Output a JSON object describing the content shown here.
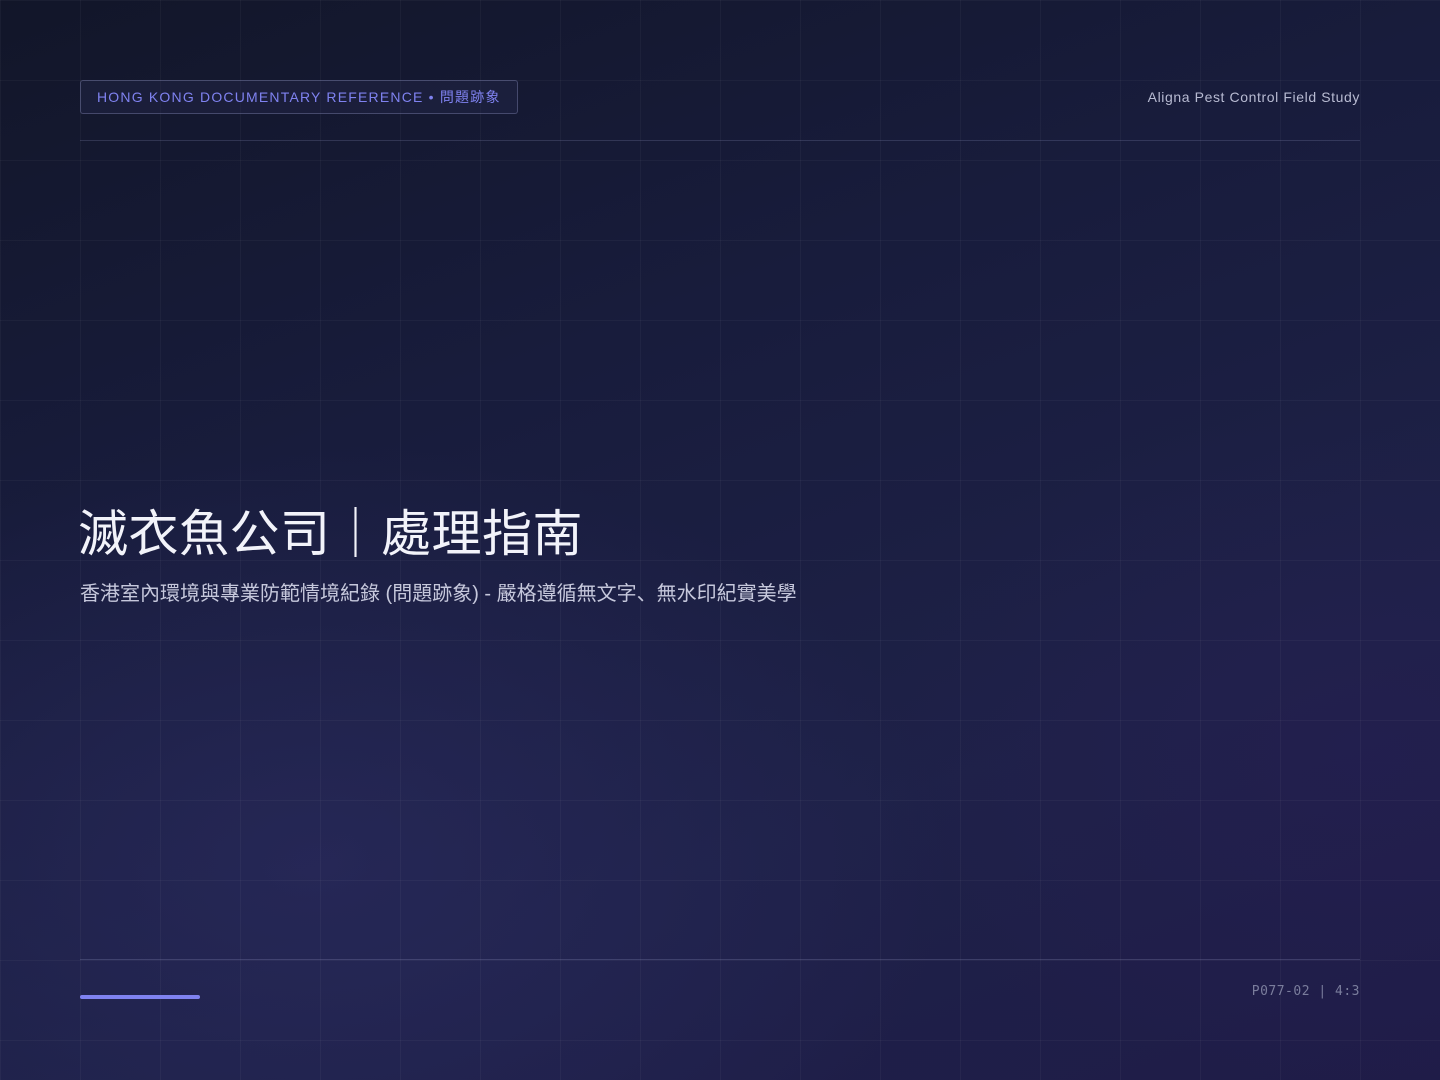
{
  "header": {
    "tag_label": "HONG KONG DOCUMENTARY REFERENCE • 問題跡象",
    "study_label": "Aligna Pest Control Field Study"
  },
  "main": {
    "title": "滅衣魚公司｜處理指南",
    "subtitle": "香港室內環境與專業防範情境紀錄 (問題跡象) - 嚴格遵循無文字、無水印紀實美學"
  },
  "footer": {
    "code": "P077-02 | 4:3"
  },
  "colors": {
    "accent": "#7f82f0",
    "background": "#181c3c"
  }
}
